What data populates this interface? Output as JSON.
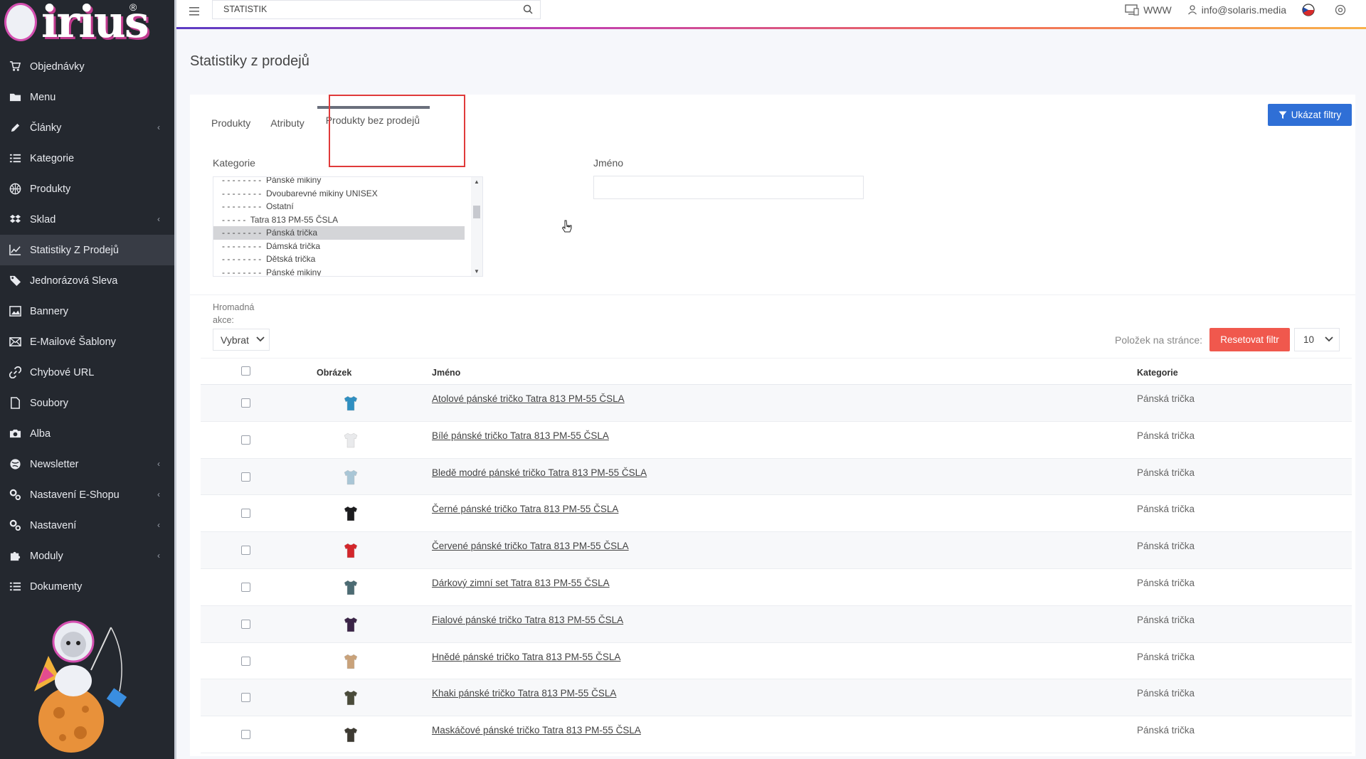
{
  "app": {
    "brand": "irius",
    "brand_reg": "®"
  },
  "sidebar": {
    "items": [
      {
        "label": "Objednávky",
        "icon": "cart-icon",
        "chevron": false,
        "active": false
      },
      {
        "label": "Menu",
        "icon": "folder-icon",
        "chevron": false,
        "active": false
      },
      {
        "label": "Články",
        "icon": "pencil-icon",
        "chevron": true,
        "active": false
      },
      {
        "label": "Kategorie",
        "icon": "list-icon",
        "chevron": false,
        "active": false
      },
      {
        "label": "Produkty",
        "icon": "basketball-icon",
        "chevron": false,
        "active": false
      },
      {
        "label": "Sklad",
        "icon": "dropbox-icon",
        "chevron": true,
        "active": false
      },
      {
        "label": "Statistiky Z Prodejů",
        "icon": "line-chart-icon",
        "chevron": false,
        "active": true
      },
      {
        "label": "Jednorázová Sleva",
        "icon": "tag-icon",
        "chevron": false,
        "active": false
      },
      {
        "label": "Bannery",
        "icon": "image-icon",
        "chevron": false,
        "active": false
      },
      {
        "label": "E-Mailové Šablony",
        "icon": "envelope-icon",
        "chevron": false,
        "active": false
      },
      {
        "label": "Chybové URL",
        "icon": "link-icon",
        "chevron": false,
        "active": false
      },
      {
        "label": "Soubory",
        "icon": "file-icon",
        "chevron": false,
        "active": false
      },
      {
        "label": "Alba",
        "icon": "camera-icon",
        "chevron": false,
        "active": false
      },
      {
        "label": "Newsletter",
        "icon": "globe-icon",
        "chevron": true,
        "active": false
      },
      {
        "label": "Nastavení E-Shopu",
        "icon": "cogs-icon",
        "chevron": true,
        "active": false
      },
      {
        "label": "Nastavení",
        "icon": "cogs-icon",
        "chevron": true,
        "active": false
      },
      {
        "label": "Moduly",
        "icon": "puzzle-icon",
        "chevron": true,
        "active": false
      },
      {
        "label": "Dokumenty",
        "icon": "list-icon",
        "chevron": false,
        "active": false
      }
    ]
  },
  "topbar": {
    "search_value": "STATISTIK",
    "www_label": "WWW",
    "user_email": "info@solaris.media"
  },
  "page": {
    "title": "Statistiky z prodejů"
  },
  "tabs": [
    {
      "label": "Produkty",
      "active": false
    },
    {
      "label": "Atributy",
      "active": false
    },
    {
      "label": "Produkty bez prodejů",
      "active": true
    }
  ],
  "filters": {
    "show_filters_label": "Ukázat filtry",
    "category_label": "Kategorie",
    "name_label": "Jméno",
    "name_value": "",
    "category_options": [
      {
        "label": "- - - - - - - -  Pánské mikiny",
        "selected": false
      },
      {
        "label": "- - - - - - - -  Dvoubarevné mikiny UNISEX",
        "selected": false
      },
      {
        "label": "- - - - - - - -  Ostatní",
        "selected": false
      },
      {
        "label": "- - - - -  Tatra 813 PM-55 ČSLA",
        "selected": false
      },
      {
        "label": "- - - - - - - -  Pánská trička",
        "selected": true
      },
      {
        "label": "- - - - - - - -  Dámská trička",
        "selected": false
      },
      {
        "label": "- - - - - - - -  Dětská trička",
        "selected": false
      },
      {
        "label": "- - - - - - - -  Pánské mikiny",
        "selected": false
      }
    ]
  },
  "bulk": {
    "label_line1": "Hromadná",
    "label_line2": "akce:",
    "select_value": "Vybrat"
  },
  "pagination": {
    "per_page_label": "Položek na stránce:",
    "reset_label": "Resetovat filtr",
    "per_page_value": "10"
  },
  "table": {
    "headers": {
      "image": "Obrázek",
      "name": "Jméno",
      "category": "Kategorie"
    },
    "rows": [
      {
        "name": "Atolové pánské tričko Tatra 813 PM-55 ČSLA",
        "category": "Pánská trička",
        "color": "#2f8fc1"
      },
      {
        "name": "Bílé pánské tričko Tatra 813 PM-55 ČSLA",
        "category": "Pánská trička",
        "color": "#e9eaec"
      },
      {
        "name": "Bledě modré pánské tričko Tatra 813 PM-55 ČSLA",
        "category": "Pánská trička",
        "color": "#a9c6d6"
      },
      {
        "name": "Černé pánské tričko Tatra 813 PM-55 ČSLA",
        "category": "Pánská trička",
        "color": "#1c1c1e"
      },
      {
        "name": "Červené pánské tričko Tatra 813 PM-55 ČSLA",
        "category": "Pánská trička",
        "color": "#d3262b"
      },
      {
        "name": "Dárkový zimní set Tatra 813 PM-55 ČSLA",
        "category": "Pánská trička",
        "color": "#4c6b73"
      },
      {
        "name": "Fialové pánské tričko Tatra 813 PM-55 ČSLA",
        "category": "Pánská trička",
        "color": "#3b2447"
      },
      {
        "name": "Hnědé pánské tričko Tatra 813 PM-55 ČSLA",
        "category": "Pánská trička",
        "color": "#c9a27a"
      },
      {
        "name": "Khaki pánské tričko Tatra 813 PM-55 ČSLA",
        "category": "Pánská trička",
        "color": "#4a4b3a"
      },
      {
        "name": "Maskáčové pánské tričko Tatra 813 PM-55 ČSLA",
        "category": "Pánská trička",
        "color": "#3d3a32"
      }
    ]
  },
  "colors": {
    "sidebar_bg": "#24282f",
    "primary": "#2f6fd6",
    "danger": "#f0584d",
    "highlight": "#e03a3a"
  }
}
